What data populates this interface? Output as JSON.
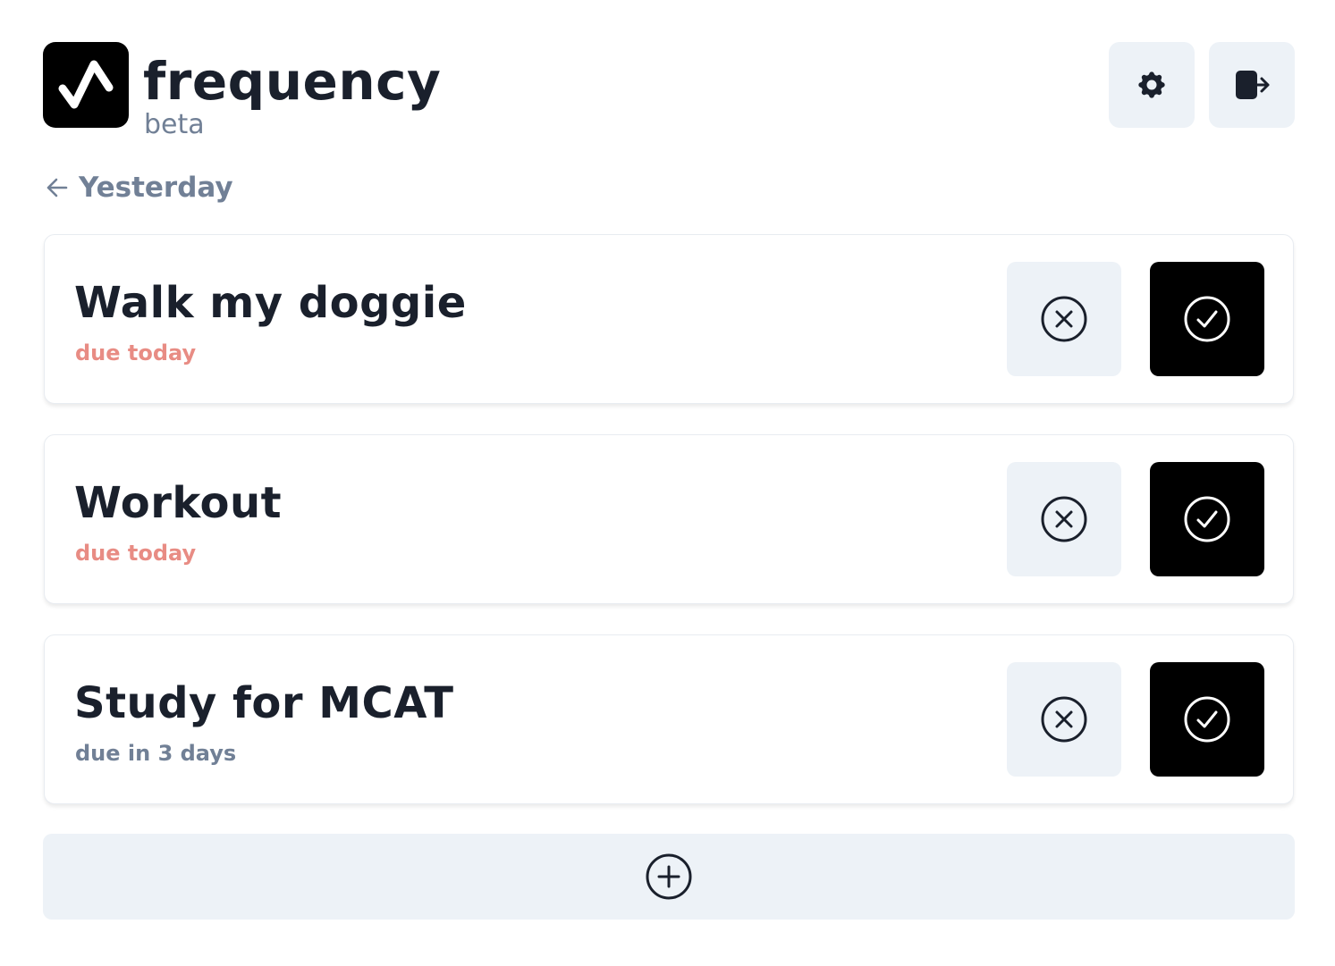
{
  "header": {
    "app_name": "frequency",
    "app_tag": "beta",
    "logo_icon": "pulse-check-icon",
    "settings_icon": "gear-icon",
    "logout_icon": "logout-icon"
  },
  "navigation": {
    "back_label": "Yesterday",
    "back_icon": "arrow-left-icon"
  },
  "tasks": [
    {
      "title": "Walk my doggie",
      "due": "due today",
      "status": "due-soon"
    },
    {
      "title": "Workout",
      "due": "due today",
      "status": "due-soon"
    },
    {
      "title": "Study for MCAT",
      "due": "due in 3 days",
      "status": "due-later"
    }
  ],
  "actions": {
    "skip_icon": "x-circle-icon",
    "complete_icon": "check-circle-icon",
    "add_icon": "plus-circle-icon"
  },
  "colors": {
    "due_soon": "#e88c84",
    "due_later": "#718096",
    "button_light": "#edf2f7",
    "button_dark": "#000000"
  }
}
